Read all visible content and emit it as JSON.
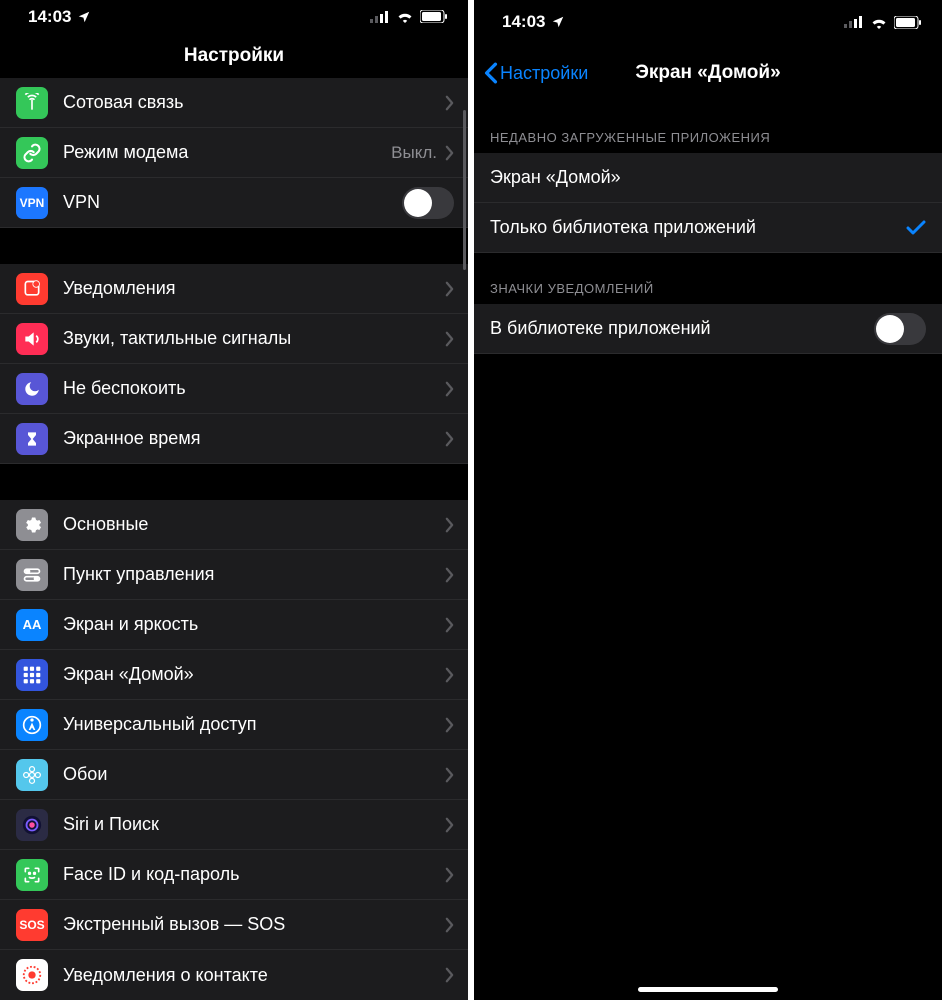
{
  "status": {
    "time": "14:03"
  },
  "left": {
    "title": "Настройки",
    "group1": [
      {
        "name": "cellular",
        "label": "Сотовая связь",
        "iconBg": "#34c759",
        "iconName": "antenna-icon",
        "iconSvg": "antenna",
        "value": "",
        "accessory": "chevron"
      },
      {
        "name": "hotspot",
        "label": "Режим модема",
        "iconBg": "#34c759",
        "iconName": "link-icon",
        "iconSvg": "link",
        "value": "Выкл.",
        "accessory": "chevron"
      },
      {
        "name": "vpn",
        "label": "VPN",
        "iconBg": "#1c77ff",
        "iconName": "vpn-icon",
        "iconSvg": "vpn",
        "value": "",
        "accessory": "toggle-off"
      }
    ],
    "group2": [
      {
        "name": "notifications",
        "label": "Уведомления",
        "iconBg": "#ff3b30",
        "iconName": "notifications-icon",
        "iconSvg": "bell",
        "accessory": "chevron"
      },
      {
        "name": "sounds",
        "label": "Звуки, тактильные сигналы",
        "iconBg": "#ff2d55",
        "iconName": "sounds-icon",
        "iconSvg": "speaker",
        "accessory": "chevron"
      },
      {
        "name": "dnd",
        "label": "Не беспокоить",
        "iconBg": "#5856d6",
        "iconName": "moon-icon",
        "iconSvg": "moon",
        "accessory": "chevron"
      },
      {
        "name": "screentime",
        "label": "Экранное время",
        "iconBg": "#5856d6",
        "iconName": "hourglass-icon",
        "iconSvg": "hourglass",
        "accessory": "chevron"
      }
    ],
    "group3": [
      {
        "name": "general",
        "label": "Основные",
        "iconBg": "#8e8e93",
        "iconName": "gear-icon",
        "iconSvg": "gear",
        "accessory": "chevron"
      },
      {
        "name": "control-center",
        "label": "Пункт управления",
        "iconBg": "#8e8e93",
        "iconName": "switches-icon",
        "iconSvg": "switches",
        "accessory": "chevron"
      },
      {
        "name": "display",
        "label": "Экран и яркость",
        "iconBg": "#0a84ff",
        "iconName": "textsize-icon",
        "iconSvg": "textsize",
        "accessory": "chevron"
      },
      {
        "name": "home-screen",
        "label": "Экран «Домой»",
        "iconBg": "#3355dd",
        "iconName": "grid-icon",
        "iconSvg": "grid",
        "accessory": "chevron"
      },
      {
        "name": "accessibility",
        "label": "Универсальный доступ",
        "iconBg": "#0a84ff",
        "iconName": "accessibility-icon",
        "iconSvg": "person",
        "accessory": "chevron"
      },
      {
        "name": "wallpaper",
        "label": "Обои",
        "iconBg": "#54c7ec",
        "iconName": "flower-icon",
        "iconSvg": "flower",
        "accessory": "chevron"
      },
      {
        "name": "siri",
        "label": "Siri и Поиск",
        "iconBg": "#2b2b44",
        "iconName": "siri-icon",
        "iconSvg": "siri",
        "accessory": "chevron"
      },
      {
        "name": "faceid",
        "label": "Face ID и код-пароль",
        "iconBg": "#34c759",
        "iconName": "faceid-icon",
        "iconSvg": "faceid",
        "accessory": "chevron"
      },
      {
        "name": "sos",
        "label": "Экстренный вызов — SOS",
        "iconBg": "#ff3b30",
        "iconName": "sos-icon",
        "iconSvg": "sos",
        "accessory": "chevron"
      },
      {
        "name": "exposure",
        "label": "Уведомления о контакте",
        "iconBg": "#ffffff",
        "iconName": "exposure-icon",
        "iconSvg": "exposure",
        "accessory": "chevron"
      }
    ]
  },
  "right": {
    "backLabel": "Настройки",
    "title": "Экран «Домой»",
    "section1Header": "НЕДАВНО ЗАГРУЖЕННЫЕ ПРИЛОЖЕНИЯ",
    "section1": [
      {
        "name": "opt-home-screen",
        "label": "Экран «Домой»",
        "checked": false
      },
      {
        "name": "opt-app-library",
        "label": "Только библиотека приложений",
        "checked": true
      }
    ],
    "section2Header": "ЗНАЧКИ УВЕДОМЛЕНИЙ",
    "section2": [
      {
        "name": "badges-in-library",
        "label": "В библиотеке приложений",
        "accessory": "toggle-off"
      }
    ]
  }
}
